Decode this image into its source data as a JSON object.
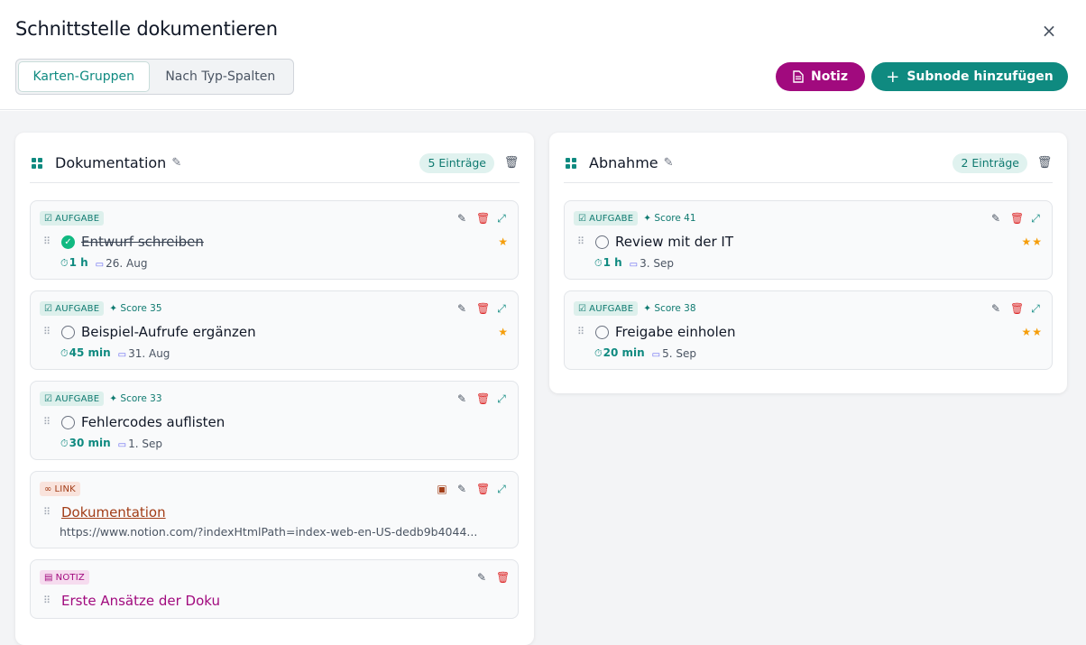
{
  "dialog": {
    "title": "Schnittstelle dokumentieren",
    "close_icon": "×"
  },
  "view_toggle": {
    "options": [
      "Karten-Gruppen",
      "Nach Typ-Spalten"
    ],
    "selected": "Karten-Gruppen"
  },
  "toolbar": {
    "note_label": "Notiz",
    "note_color": "#a10a7e",
    "add_subnode_label": "Subnode hinzufügen",
    "add_subnode_color": "#0f8a80"
  },
  "groups": [
    {
      "title": "Dokumentation",
      "count_label": "5 Einträge",
      "items": [
        {
          "type": "task",
          "tag": "AUFGABE",
          "score": "",
          "title": "Entwurf schreiben",
          "done": true,
          "stars": "★",
          "duration": "1 h",
          "date": "26. Aug"
        },
        {
          "type": "task",
          "tag": "AUFGABE",
          "score": "Score 35",
          "title": "Beispiel-Aufrufe ergänzen",
          "done": false,
          "stars": "★",
          "duration": "45 min",
          "date": "31. Aug"
        },
        {
          "type": "task",
          "tag": "AUFGABE",
          "score": "Score 33",
          "title": "Fehlercodes auflisten",
          "done": false,
          "stars": "",
          "duration": "30 min",
          "date": "1. Sep"
        },
        {
          "type": "link",
          "tag": "LINK",
          "title": "Dokumentation",
          "url": "https://www.notion.com/?indexHtmlPath=index-web-en-US-dedb9b4044..."
        },
        {
          "type": "note",
          "tag": "NOTIZ",
          "title": "Erste Ansätze der Doku"
        }
      ]
    },
    {
      "title": "Abnahme",
      "count_label": "2 Einträge",
      "items": [
        {
          "type": "task",
          "tag": "AUFGABE",
          "score": "Score 41",
          "title": "Review mit der IT",
          "done": false,
          "stars": "★★",
          "duration": "1 h",
          "date": "3. Sep"
        },
        {
          "type": "task",
          "tag": "AUFGABE",
          "score": "Score 38",
          "title": "Freigabe einholen",
          "done": false,
          "stars": "★★",
          "duration": "20 min",
          "date": "5. Sep"
        }
      ]
    }
  ],
  "icons": {
    "edit": "pencil-icon",
    "delete": "trash-icon",
    "expand": "expand-icon",
    "calendar": "calendar-icon",
    "timer": "stopwatch-icon",
    "drag": "drag-handle-icon",
    "group": "grid-icon"
  }
}
